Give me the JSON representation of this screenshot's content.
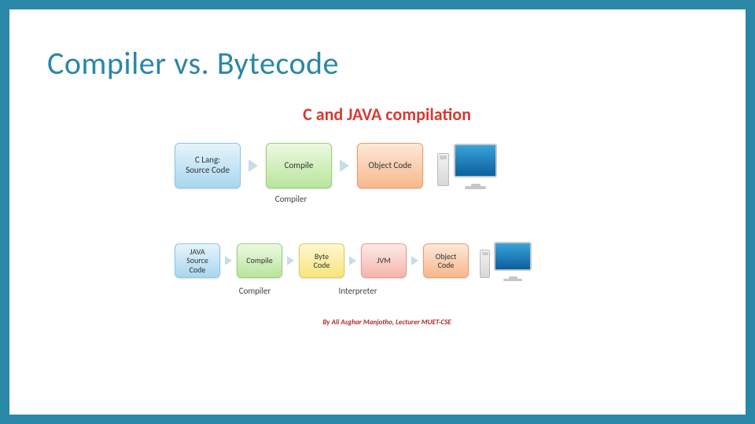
{
  "slide": {
    "title": "Compiler vs. Bytecode",
    "diagram_title": "C and JAVA compilation",
    "credit": "By Ali Asghar Manjotho, Lecturer MUET-CSE"
  },
  "c_flow": {
    "steps": [
      {
        "label": "C Lang:\nSource Code"
      },
      {
        "label": "Compile"
      },
      {
        "label": "Object Code"
      }
    ],
    "caption": "Compiler"
  },
  "java_flow": {
    "steps": [
      {
        "label": "JAVA\nSource\nCode"
      },
      {
        "label": "Compile"
      },
      {
        "label": "Byte\nCode"
      },
      {
        "label": "JVM"
      },
      {
        "label": "Object\nCode"
      }
    ],
    "captions": {
      "compiler": "Compiler",
      "interpreter": "Interpreter"
    }
  }
}
